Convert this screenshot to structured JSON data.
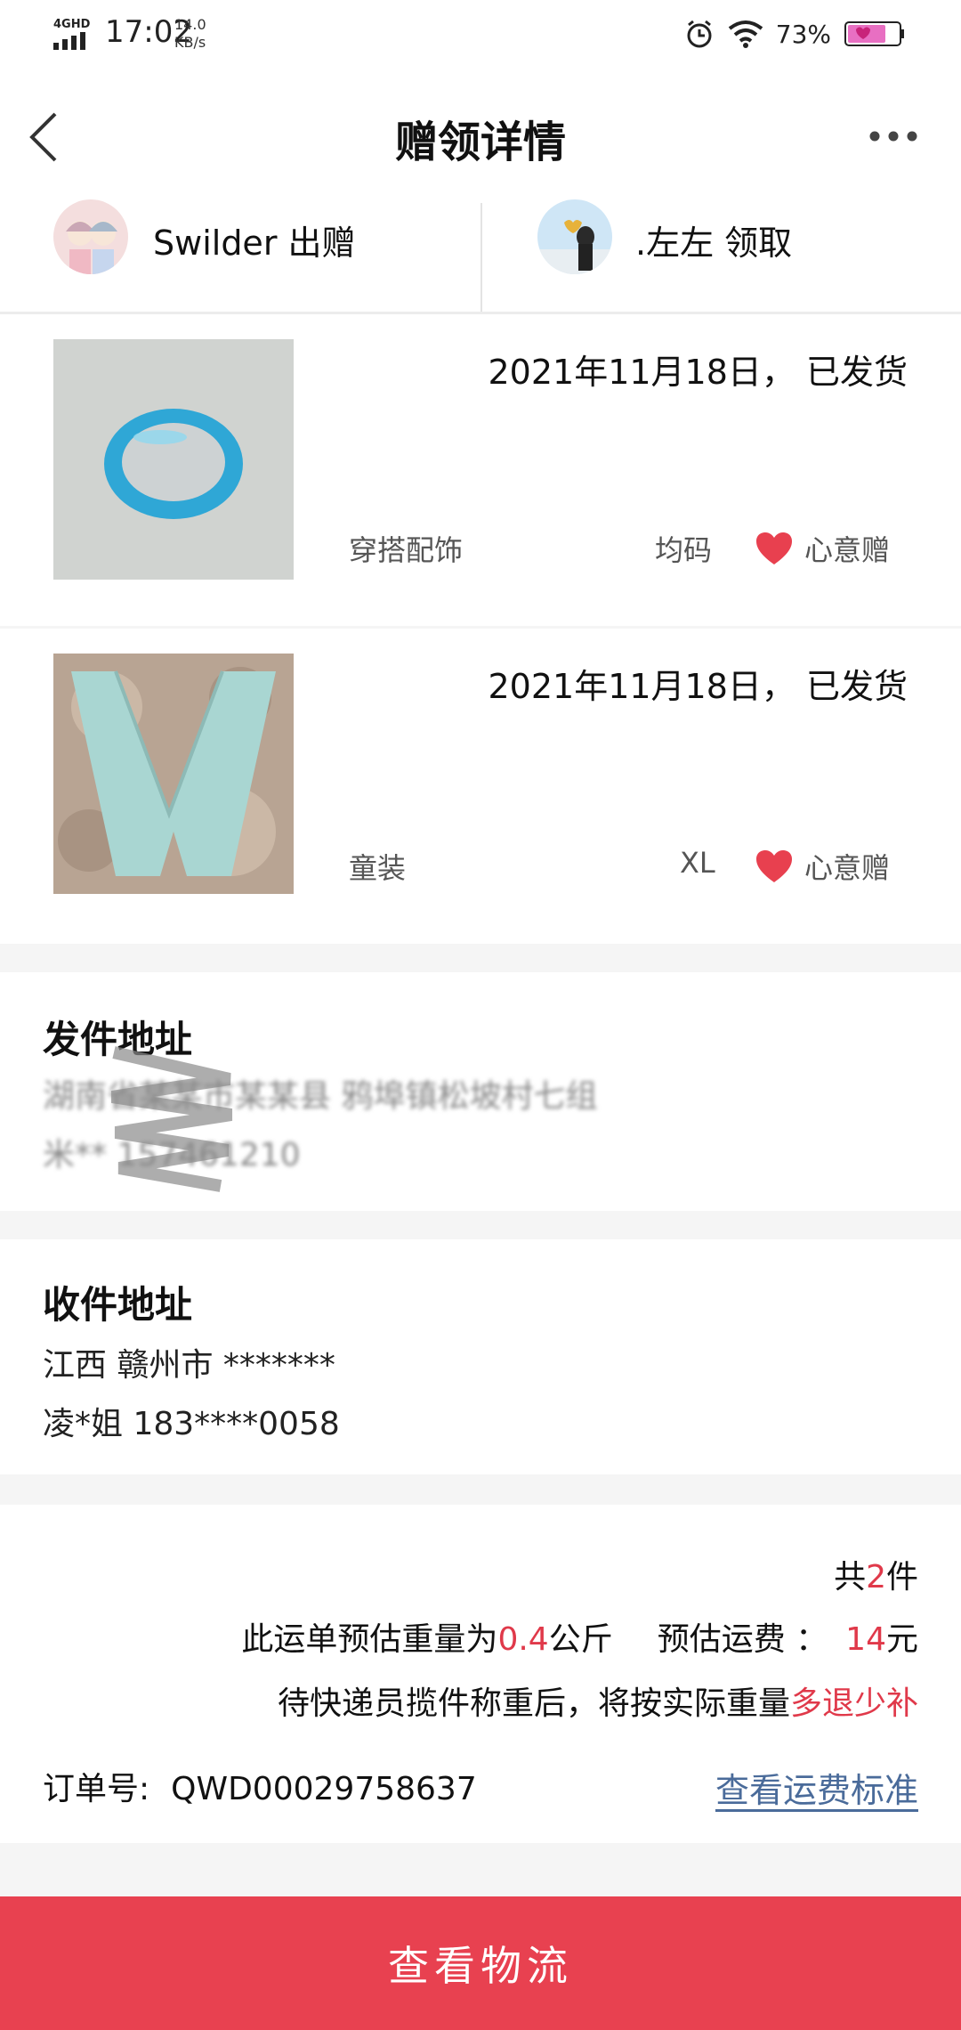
{
  "status_bar": {
    "network": "4GHD",
    "time": "17:02",
    "speed_value": "14.0",
    "speed_unit": "KB/s",
    "battery": "73%"
  },
  "header": {
    "title": "赠领详情"
  },
  "parties": {
    "giver_name": "Swilder 出赠",
    "receiver_name": ".左左 领取"
  },
  "items": [
    {
      "date_status": "2021年11月18日， 已发货",
      "category": "穿搭配饰",
      "size": "均码",
      "gift_label": "心意赠"
    },
    {
      "date_status": "2021年11月18日， 已发货",
      "category": "童装",
      "size": "XL",
      "gift_label": "心意赠"
    }
  ],
  "sender_address": {
    "title": "发件地址",
    "line1": "湖南省某某市某某县 鸦埠镇松坡村七组",
    "line2": "米**  157461210"
  },
  "receiver_address": {
    "title": "收件地址",
    "line1": "江西 赣州市 *******",
    "line2": "凌*姐 183****0058"
  },
  "order": {
    "count_prefix": "共",
    "count": "2",
    "count_suffix": "件",
    "weight_prefix": "此运单预估重量为",
    "weight_value": "0.4",
    "weight_unit": "公斤",
    "fee_label": "预估运费 ：",
    "fee_value": "14",
    "fee_unit": "元",
    "note_prefix": "待快递员揽件称重后，将按实际重量",
    "note_highlight": "多退少补",
    "order_no_label": "订单号:",
    "order_no": "QWD00029758637",
    "fee_standard_link": "查看运费标准"
  },
  "bottom_button": {
    "label": "查看物流"
  },
  "colors": {
    "accent": "#e84150",
    "highlight": "#e0394a",
    "link": "#4a6b9a"
  }
}
